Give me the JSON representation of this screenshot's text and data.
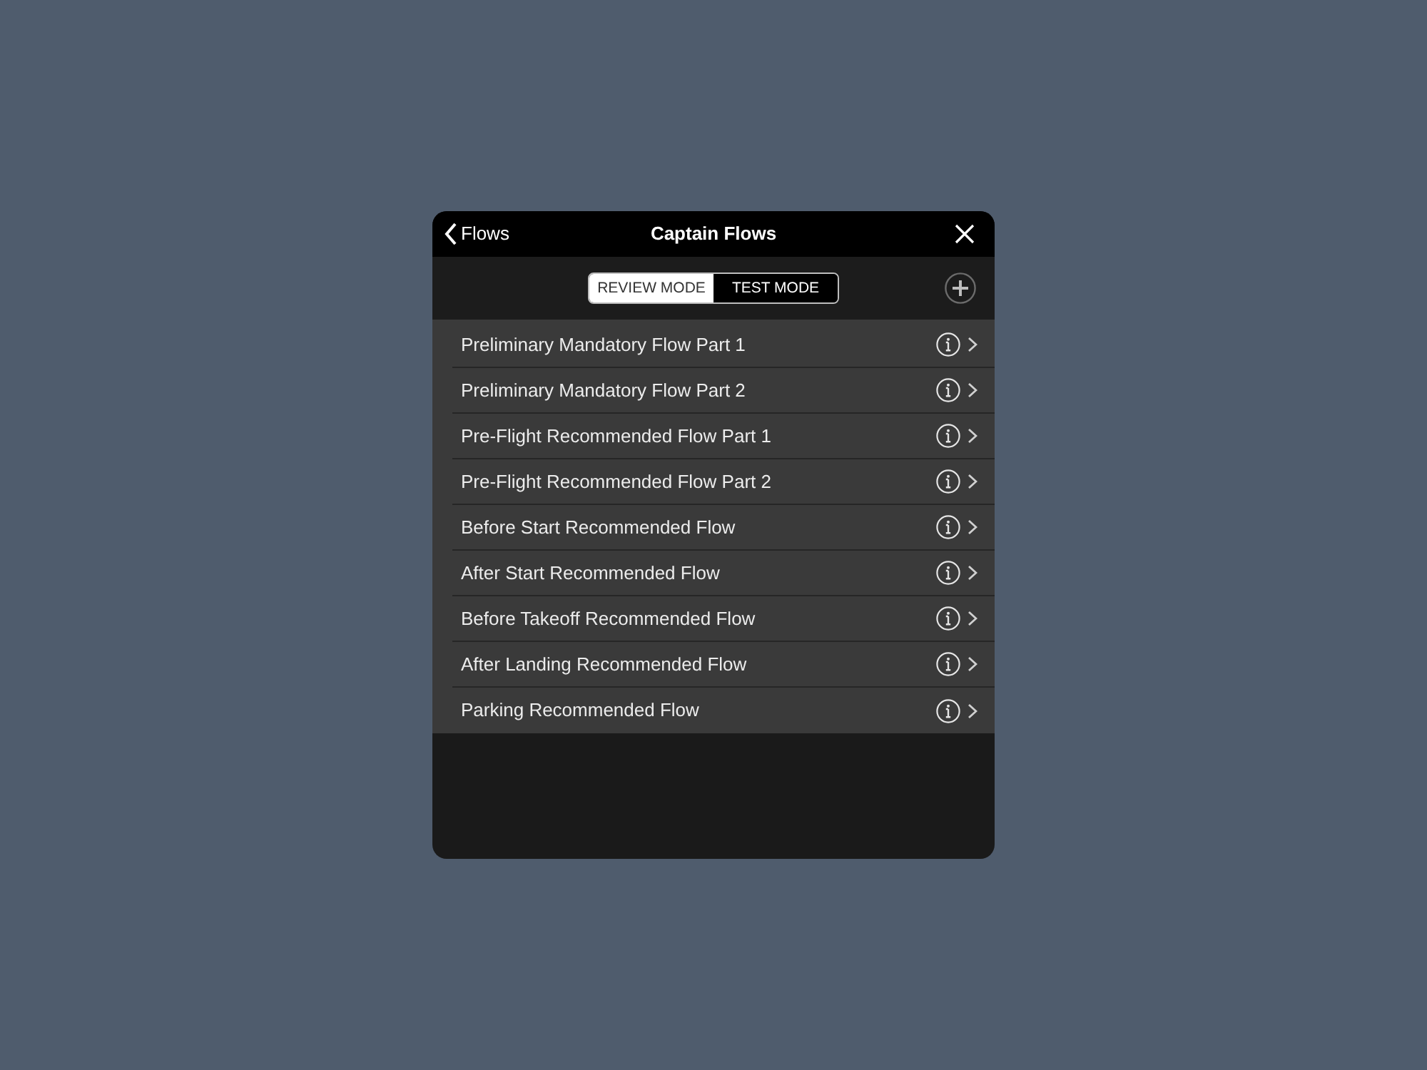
{
  "dialog": {
    "back_button": {
      "label": "Flows"
    },
    "title": "Captain Flows",
    "mode_tabs": [
      {
        "label": "REVIEW MODE",
        "selected": true
      },
      {
        "label": "TEST MODE",
        "selected": false
      }
    ],
    "flows": [
      {
        "label": "Preliminary Mandatory Flow Part 1"
      },
      {
        "label": "Preliminary Mandatory Flow Part 2"
      },
      {
        "label": "Pre-Flight Recommended Flow Part 1"
      },
      {
        "label": "Pre-Flight Recommended Flow Part 2"
      },
      {
        "label": "Before Start Recommended Flow"
      },
      {
        "label": "After Start Recommended Flow"
      },
      {
        "label": "Before Takeoff Recommended Flow"
      },
      {
        "label": "After Landing Recommended Flow"
      },
      {
        "label": "Parking Recommended Flow"
      }
    ]
  }
}
